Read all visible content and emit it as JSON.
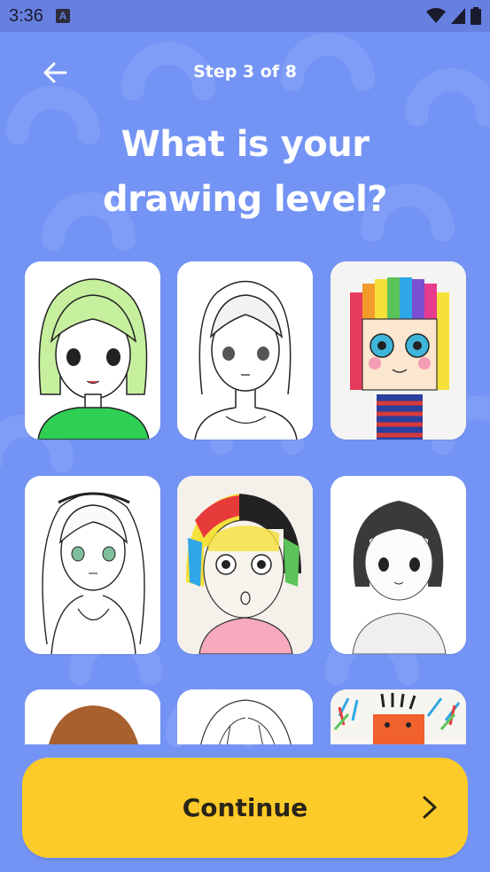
{
  "status_bar": {
    "time": "3:36",
    "notification_icon_letter": "A"
  },
  "header": {
    "step_label": "Step 3 of 8"
  },
  "title": {
    "line1": "What is your",
    "line2": "drawing level?"
  },
  "cards": [
    {
      "icon": "anime-girl-green-hair-drawing"
    },
    {
      "icon": "anime-girl-lineart-drawing"
    },
    {
      "icon": "rainbow-hair-girl-drawing"
    },
    {
      "icon": "long-hair-anime-girl-drawing"
    },
    {
      "icon": "colorful-hair-child-drawing"
    },
    {
      "icon": "short-bob-girl-pencil-drawing"
    },
    {
      "icon": "brown-hair-drawing"
    },
    {
      "icon": "sketch-hair-drawing"
    },
    {
      "icon": "scribble-crayon-drawing"
    }
  ],
  "continue_button": {
    "label": "Continue"
  },
  "colors": {
    "background": "#7494f5",
    "button": "#fdcb29",
    "title_text": "#ffffff"
  }
}
